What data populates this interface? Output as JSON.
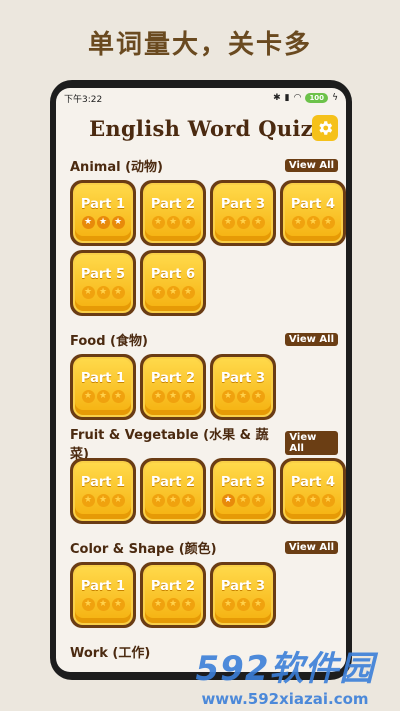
{
  "promo_caption": "单词量大，关卡多",
  "status": {
    "time": "下午3:22",
    "battery": "100"
  },
  "app_title": "English Word Quiz",
  "view_all_label": "View All",
  "sections": [
    {
      "title": "Animal (动物)",
      "parts": [
        {
          "label": "Part 1",
          "stars": 3
        },
        {
          "label": "Part 2",
          "stars": 0
        },
        {
          "label": "Part 3",
          "stars": 0
        },
        {
          "label": "Part 4",
          "stars": 0
        },
        {
          "label": "Part 5",
          "stars": 0
        },
        {
          "label": "Part 6",
          "stars": 0
        }
      ]
    },
    {
      "title": "Food (食物)",
      "parts": [
        {
          "label": "Part 1",
          "stars": 0
        },
        {
          "label": "Part 2",
          "stars": 0
        },
        {
          "label": "Part 3",
          "stars": 0
        }
      ]
    },
    {
      "title": "Fruit & Vegetable (水果 & 蔬菜)",
      "parts": [
        {
          "label": "Part 1",
          "stars": 0
        },
        {
          "label": "Part 2",
          "stars": 0
        },
        {
          "label": "Part 3",
          "stars": 1
        },
        {
          "label": "Part 4",
          "stars": 0
        }
      ]
    },
    {
      "title": "Color & Shape (颜色)",
      "parts": [
        {
          "label": "Part 1",
          "stars": 0
        },
        {
          "label": "Part 2",
          "stars": 0
        },
        {
          "label": "Part 3",
          "stars": 0
        }
      ]
    },
    {
      "title": "Work (工作)",
      "parts": []
    }
  ],
  "watermark": {
    "top": "592软件园",
    "bottom": "www.592xiazai.com"
  },
  "colors": {
    "tile_fill": "#f5b10f",
    "tile_border": "#6a3c14",
    "accent": "#f5c11a"
  },
  "icons": {
    "settings": "gear-icon",
    "star": "star-icon"
  }
}
